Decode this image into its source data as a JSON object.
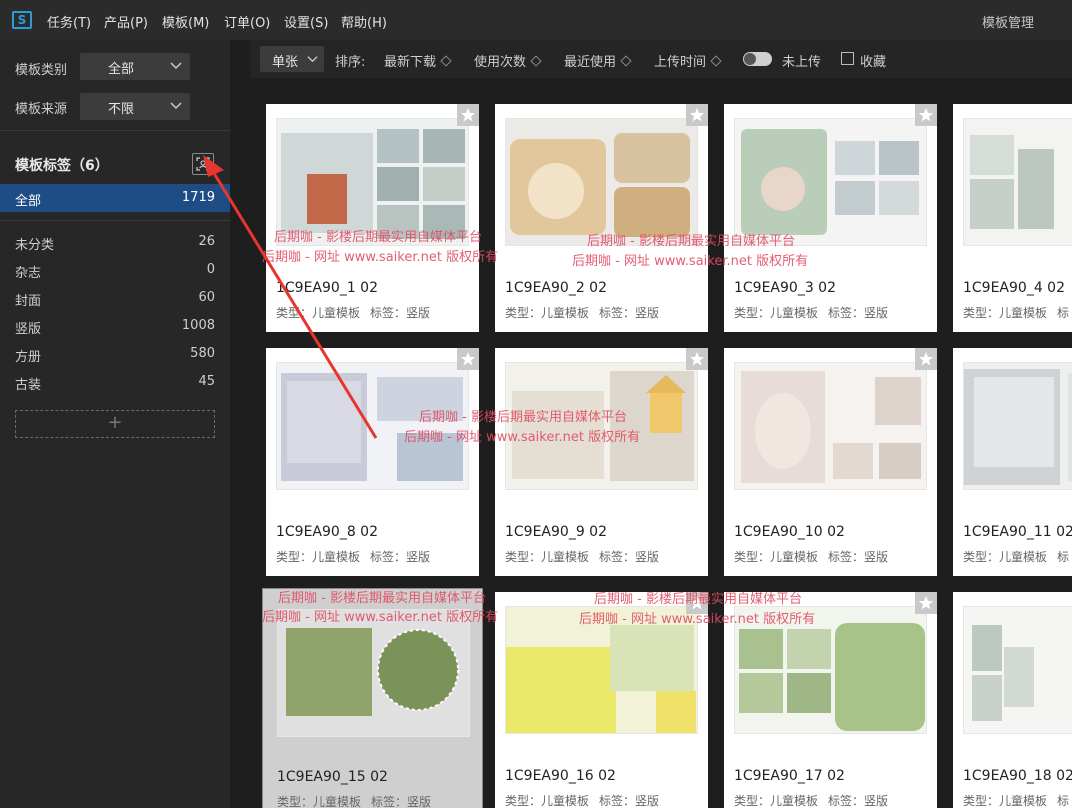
{
  "menubar": {
    "logo": "S",
    "items": [
      "任务(T)",
      "产品(P)",
      "模板(M)",
      "订单(O)",
      "设置(S)",
      "帮助(H)"
    ],
    "window_title": "模板管理"
  },
  "sidebar": {
    "category_label": "模板类别",
    "category_value": "全部",
    "source_label": "模板来源",
    "source_value": "不限",
    "tags_title": "模板标签（6）",
    "tags": [
      {
        "name": "全部",
        "count": "1719",
        "active": true
      },
      {
        "name": "未分类",
        "count": "26"
      },
      {
        "name": "杂志",
        "count": "0"
      },
      {
        "name": "封面",
        "count": "60"
      },
      {
        "name": "竖版",
        "count": "1008"
      },
      {
        "name": "方册",
        "count": "580"
      },
      {
        "name": "古装",
        "count": "45"
      }
    ],
    "add_symbol": "+"
  },
  "toolbar": {
    "mode": "单张",
    "sort_label": "排序:",
    "sort_options": [
      "最新下载",
      "使用次数",
      "最近使用",
      "上传时间"
    ],
    "upload_label": "未上传",
    "favorite_label": "收藏"
  },
  "cards": [
    {
      "title": "1C9EA90_1  02",
      "type": "类型：儿童模板",
      "tag": "标签：竖版"
    },
    {
      "title": "1C9EA90_2  02",
      "type": "类型：儿童模板",
      "tag": "标签：竖版"
    },
    {
      "title": "1C9EA90_3  02",
      "type": "类型：儿童模板",
      "tag": "标签：竖版"
    },
    {
      "title": "1C9EA90_4  02",
      "type": "类型：儿童模板",
      "tag": "标"
    },
    {
      "title": "1C9EA90_8  02",
      "type": "类型：儿童模板",
      "tag": "标签：竖版"
    },
    {
      "title": "1C9EA90_9  02",
      "type": "类型：儿童模板",
      "tag": "标签：竖版"
    },
    {
      "title": "1C9EA90_10  02",
      "type": "类型：儿童模板",
      "tag": "标签：竖版"
    },
    {
      "title": "1C9EA90_11  02",
      "type": "类型：儿童模板",
      "tag": "标"
    },
    {
      "title": "1C9EA90_15  02",
      "type": "类型：儿童模板",
      "tag": "标签：竖版"
    },
    {
      "title": "1C9EA90_16  02",
      "type": "类型：儿童模板",
      "tag": "标签：竖版"
    },
    {
      "title": "1C9EA90_17  02",
      "type": "类型：儿童模板",
      "tag": "标签：竖版"
    },
    {
      "title": "1C9EA90_18  02",
      "type": "类型：儿童模板",
      "tag": "标"
    }
  ],
  "watermark": {
    "line1": "后期咖 - 影楼后期最实用自媒体平台",
    "line2": "后期咖 - 网址 www.saiker.net 版权所有"
  },
  "colors": {
    "accent": "#1e4d86",
    "logo": "#2e9bd6",
    "watermark": "#e14c63",
    "annotation": "#e8352f"
  }
}
